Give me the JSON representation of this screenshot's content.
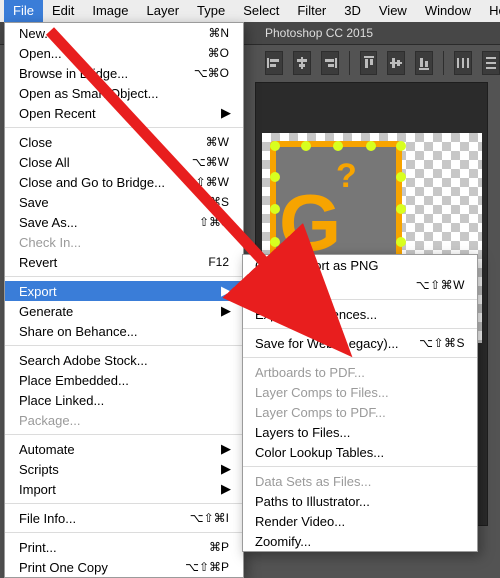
{
  "menubar": {
    "items": [
      "File",
      "Edit",
      "Image",
      "Layer",
      "Type",
      "Select",
      "Filter",
      "3D",
      "View",
      "Window",
      "Help"
    ],
    "selected_index": 0
  },
  "app": {
    "title_fragment": "Photoshop CC 2015"
  },
  "file_menu": {
    "groups": [
      [
        {
          "label": "New...",
          "shortcut": "⌘N"
        },
        {
          "label": "Open...",
          "shortcut": "⌘O"
        },
        {
          "label": "Browse in Bridge...",
          "shortcut": "⌥⌘O"
        },
        {
          "label": "Open as Smart Object..."
        },
        {
          "label": "Open Recent",
          "submenu": true
        }
      ],
      [
        {
          "label": "Close",
          "shortcut": "⌘W"
        },
        {
          "label": "Close All",
          "shortcut": "⌥⌘W"
        },
        {
          "label": "Close and Go to Bridge...",
          "shortcut": "⇧⌘W"
        },
        {
          "label": "Save",
          "shortcut": "⌘S"
        },
        {
          "label": "Save As...",
          "shortcut": "⇧⌘S"
        },
        {
          "label": "Check In...",
          "disabled": true
        },
        {
          "label": "Revert",
          "shortcut": "F12"
        }
      ],
      [
        {
          "label": "Export",
          "submenu": true,
          "selected": true
        },
        {
          "label": "Generate",
          "submenu": true
        },
        {
          "label": "Share on Behance..."
        }
      ],
      [
        {
          "label": "Search Adobe Stock..."
        },
        {
          "label": "Place Embedded..."
        },
        {
          "label": "Place Linked..."
        },
        {
          "label": "Package...",
          "disabled": true
        }
      ],
      [
        {
          "label": "Automate",
          "submenu": true
        },
        {
          "label": "Scripts",
          "submenu": true
        },
        {
          "label": "Import",
          "submenu": true
        }
      ],
      [
        {
          "label": "File Info...",
          "shortcut": "⌥⇧⌘I"
        }
      ],
      [
        {
          "label": "Print...",
          "shortcut": "⌘P"
        },
        {
          "label": "Print One Copy",
          "shortcut": "⌥⇧⌘P"
        }
      ]
    ]
  },
  "export_submenu": {
    "groups": [
      [
        {
          "label": "Quick Export as PNG"
        },
        {
          "label": "Export As...",
          "shortcut": "⌥⇧⌘W"
        }
      ],
      [
        {
          "label": "Export Preferences..."
        }
      ],
      [
        {
          "label": "Save for Web (Legacy)...",
          "shortcut": "⌥⇧⌘S"
        }
      ],
      [
        {
          "label": "Artboards to PDF...",
          "disabled": true
        },
        {
          "label": "Layer Comps to Files...",
          "disabled": true
        },
        {
          "label": "Layer Comps to PDF...",
          "disabled": true
        },
        {
          "label": "Layers to Files..."
        },
        {
          "label": "Color Lookup Tables..."
        }
      ],
      [
        {
          "label": "Data Sets as Files...",
          "disabled": true
        },
        {
          "label": "Paths to Illustrator..."
        },
        {
          "label": "Render Video..."
        },
        {
          "label": "Zoomify..."
        }
      ]
    ]
  },
  "canvas": {
    "big_letter": "G",
    "question": "?"
  }
}
